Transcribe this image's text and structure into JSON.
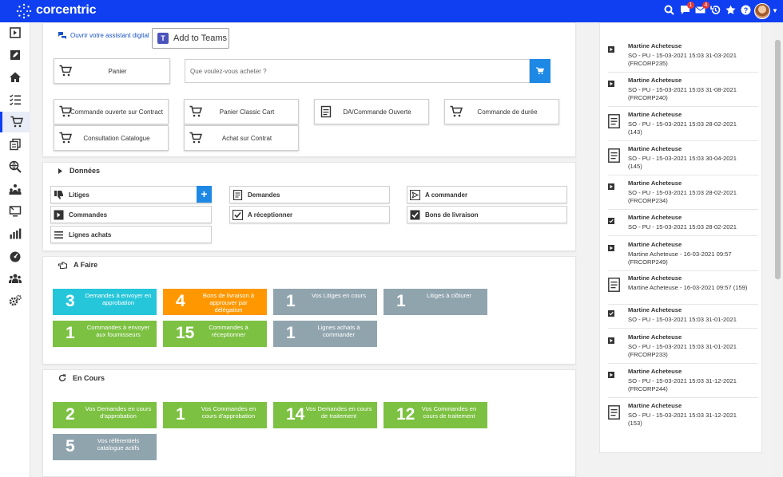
{
  "brand": {
    "name": "corcentric"
  },
  "topbar": {
    "badges": [
      "1",
      "4"
    ]
  },
  "assistant": {
    "label": "Ouvrir votre assistant digital"
  },
  "teams": {
    "label": "Add to Teams"
  },
  "shop": {
    "panier": "Panier",
    "search_placeholder": "Que voulez-vous acheter ?",
    "buttons": [
      "Commande ouverte sur Contract",
      "Panier Classic Cart",
      "DA/Commande Ouverte",
      "Commande de durée",
      "Consultation Catalogue",
      "Achat sur Contrat"
    ]
  },
  "donnees": {
    "title": "Données",
    "items": [
      "Litiges",
      "Demandes",
      "A commander",
      "Commandes",
      "A réceptionner",
      "Bons de livraison",
      "Lignes achats"
    ]
  },
  "afaire": {
    "title": "A Faire",
    "tiles": [
      {
        "num": "3",
        "text": "Demandes à envoyer en approbation",
        "color": "#26c6da"
      },
      {
        "num": "4",
        "text": "Bons de livraison à approuver par délégation",
        "color": "#ff9800"
      },
      {
        "num": "1",
        "text": "Vos Litiges en cours",
        "color": "#90a4ae"
      },
      {
        "num": "1",
        "text": "Litiges à clôturer",
        "color": "#90a4ae"
      },
      {
        "num": "1",
        "text": "Commandes à envoyer aux fournisseurs",
        "color": "#7cc142"
      },
      {
        "num": "15",
        "text": "Commandes à réceptionner",
        "color": "#7cc142"
      },
      {
        "num": "1",
        "text": "Lignes achats à commander",
        "color": "#90a4ae"
      }
    ]
  },
  "encours": {
    "title": "En Cours",
    "tiles": [
      {
        "num": "2",
        "text": "Vos Demandes en cours d'approbation",
        "color": "#7cc142"
      },
      {
        "num": "1",
        "text": "Vos Commandes en cours d'approbation",
        "color": "#7cc142"
      },
      {
        "num": "14",
        "text": "Vos Demandes en cours de traitement",
        "color": "#7cc142"
      },
      {
        "num": "12",
        "text": "Vos Commandes en cours de traitement",
        "color": "#7cc142"
      },
      {
        "num": "5",
        "text": "Vos référentiels catalogue actifs",
        "color": "#90a4ae"
      }
    ]
  },
  "activity": [
    {
      "name": "Martine Acheteuse",
      "line1": "SO - PU - 15-03-2021 15:03 31-03-2021",
      "line2": "(FRCORP235)",
      "icon": "play-icon"
    },
    {
      "name": "Martine Acheteuse",
      "line1": "SO - PU - 15-03-2021 15:03 31-08-2021",
      "line2": "(FRCORP240)",
      "icon": "play-icon"
    },
    {
      "name": "Martine Acheteuse",
      "line1": "SO - PU - 15-03-2021 15:03 28-02-2021",
      "line2": "(143)",
      "icon": "document-icon"
    },
    {
      "name": "Martine Acheteuse",
      "line1": "SO - PU - 15-03-2021 15:03 30-04-2021",
      "line2": "(145)",
      "icon": "document-icon"
    },
    {
      "name": "Martine Acheteuse",
      "line1": "SO - PU - 15-03-2021 15:03 28-02-2021",
      "line2": "(FRCORP234)",
      "icon": "play-icon"
    },
    {
      "name": "Martine Acheteuse",
      "line1": "SO - PU - 15-03-2021 15:03 28-02-2021",
      "line2": "",
      "icon": "checkbox-icon"
    },
    {
      "name": "Martine Acheteuse",
      "line1": "Martine Acheteuse - 16-03-2021 09:57",
      "line2": "(FRCORP249)",
      "icon": "play-icon"
    },
    {
      "name": "Martine Acheteuse",
      "line1": "Martine Acheteuse - 16-03-2021 09:57 (159)",
      "line2": "",
      "icon": "document-icon"
    },
    {
      "name": "Martine Acheteuse",
      "line1": "SO - PU - 15-03-2021 15:03 31-01-2021",
      "line2": "",
      "icon": "checkbox-icon"
    },
    {
      "name": "Martine Acheteuse",
      "line1": "SO - PU - 15-03-2021 15:03 31-01-2021",
      "line2": "(FRCORP233)",
      "icon": "play-icon"
    },
    {
      "name": "Martine Acheteuse",
      "line1": "SO - PU - 15-03-2021 15:03 31-12-2021",
      "line2": "(FRCORP244)",
      "icon": "play-icon"
    },
    {
      "name": "Martine Acheteuse",
      "line1": "SO - PU - 15-03-2021 15:03 31-12-2021",
      "line2": "(153)",
      "icon": "document-icon"
    }
  ]
}
